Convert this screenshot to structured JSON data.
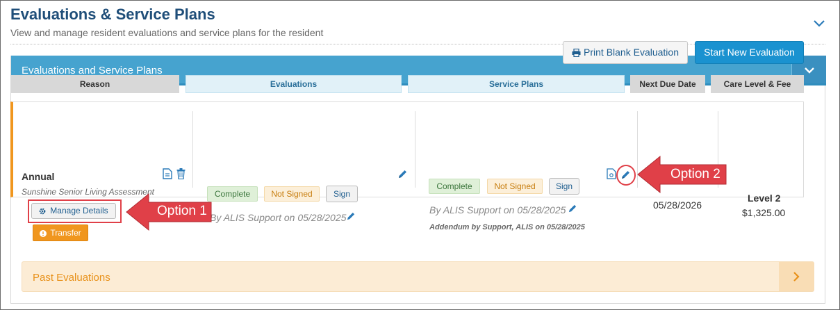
{
  "page": {
    "title": "Evaluations & Service Plans",
    "subtitle": "View and manage resident evaluations and service plans for the resident"
  },
  "panel": {
    "title": "Evaluations and Service Plans"
  },
  "actions": {
    "print_label": "Print Blank Evaluation",
    "new_label": "Start New Evaluation"
  },
  "columns": {
    "reason": "Reason",
    "evaluations": "Evaluations",
    "service_plans": "Service Plans",
    "next_due": "Next Due Date",
    "care_level": "Care Level & Fee"
  },
  "row": {
    "reason": {
      "title": "Annual",
      "assessment": "Sunshine Senior Living Assessment",
      "manage_label": "Manage Details",
      "transfer_label": "Transfer"
    },
    "evaluation": {
      "status": "Complete",
      "sign_status": "Not Signed",
      "sign_label": "Sign",
      "by": "By ALIS Support on 05/28/2025"
    },
    "service_plan": {
      "status": "Complete",
      "sign_status": "Not Signed",
      "sign_label": "Sign",
      "by": "By ALIS Support on 05/28/2025",
      "addendum": "Addendum by Support, ALIS on 05/28/2025"
    },
    "next_due_date": "05/28/2026",
    "care_level": "Level 2",
    "care_fee": "$1,325.00"
  },
  "callouts": {
    "option1": "Option 1",
    "option2": "Option 2"
  },
  "past": {
    "label": "Past Evaluations"
  },
  "colors": {
    "panel_header": "#46a3cf",
    "primary_button": "#1a92d0",
    "accent_orange": "#f0961e",
    "callout_red": "#e04048"
  }
}
